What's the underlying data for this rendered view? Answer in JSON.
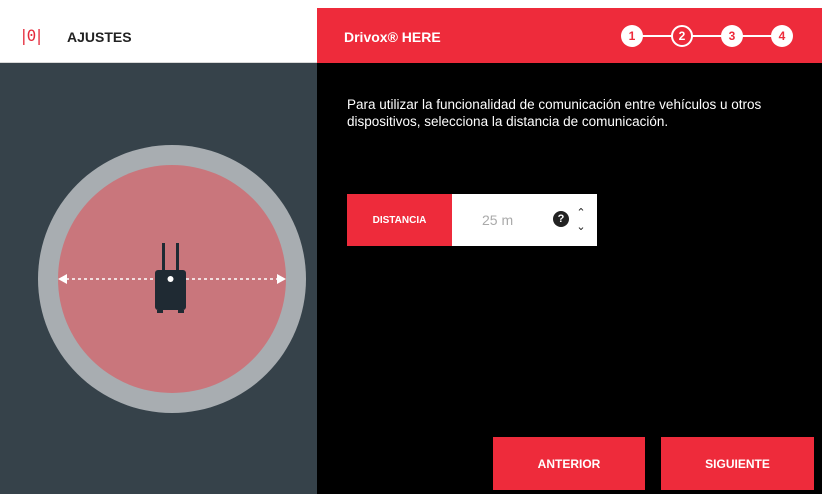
{
  "header": {
    "logo_text": "|0|",
    "section_title": "AJUSTES",
    "app_title": "Drivox® HERE",
    "steps": [
      "1",
      "2",
      "3",
      "4"
    ],
    "current_step": 2
  },
  "content": {
    "instructions": "Para utilizar la funcionalidad de comunicación entre vehículos u otros dispositivos, selecciona la distancia de comunicación.",
    "distance_label": "DISTANCIA",
    "distance_value": "25 m",
    "help_icon": "question-circle-icon",
    "stepper_up": "⌃",
    "stepper_down": "⌄"
  },
  "buttons": {
    "previous": "ANTERIOR",
    "next": "SIGUIENTE"
  },
  "colors": {
    "accent": "#ee2b3b",
    "left_panel": "#36424a",
    "range_fill": "#c9767c",
    "range_ring": "#a8adb1",
    "device": "#1f2a33"
  }
}
